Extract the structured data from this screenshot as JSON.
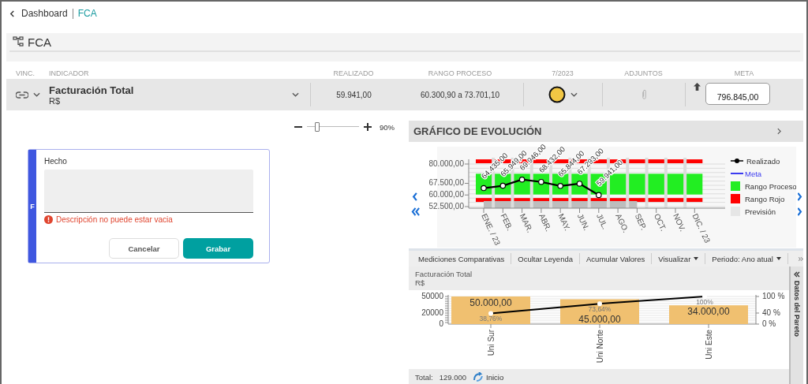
{
  "breadcrumb": [
    {
      "label": "Dashboard",
      "selected": false
    },
    {
      "label": "FCA",
      "selected": true
    }
  ],
  "section": {
    "title": "FCA"
  },
  "table": {
    "columns": [
      "VINC.",
      "INDICADOR",
      "REALIZADO",
      "RANGO PROCESO",
      "7/2023",
      "ADJUNTOS",
      "META"
    ],
    "row": {
      "indicator": "Facturación Total",
      "unit": "R$",
      "realizado": "59.941,00",
      "rango_proceso": "60.300,90 a 73.701,10",
      "status_dot": {
        "color": "#f2c744"
      },
      "trend_up": true,
      "meta": "796.845,00"
    }
  },
  "zoom": {
    "level": 0.18,
    "reading": "90%"
  },
  "form": {
    "side_label": "F",
    "field_label": "Hecho",
    "error": "Descripción no puede estar vacia",
    "buttons": [
      {
        "label": "Cancelar",
        "kind": "secondary"
      },
      {
        "label": "Grabar",
        "kind": "primary"
      }
    ]
  },
  "evolution": {
    "title": "GRÁFICO DE EVOLUCIÓN",
    "chart_data": {
      "type": "line",
      "categories": [
        "ENE. / 23",
        "FEB.",
        "MAR.",
        "ABR.",
        "MAY.",
        "JUN.",
        "JUL.",
        "AGO.",
        "SEP.",
        "OCT.",
        "NOV.",
        "DIC. / 23"
      ],
      "series": [
        {
          "name": "Realizado",
          "color": "#000000",
          "marker": "circle",
          "values": [
            64435,
            65949,
            69946,
            68432,
            65844,
            67293,
            59941,
            null,
            null,
            null,
            null,
            null
          ]
        }
      ],
      "bands": [
        {
          "axis": "y",
          "from": 60300.9,
          "to": 73701.1,
          "color": "#22ee22"
        },
        {
          "axis": "y",
          "from": 80500,
          "to": 83000,
          "color": "#ff0000"
        },
        {
          "axis": "y",
          "from": 55500,
          "to": 58000,
          "color": "#ff0000"
        },
        {
          "axis": "x",
          "from": "ENE. / 23",
          "to": "SEP.",
          "color": "#bdbdbd"
        }
      ],
      "value_labels": [
        "64.435,00",
        "65.949,00",
        "69.946,00",
        "68.432,00",
        "65.844,00",
        "67.293,00",
        "59.941,00",
        null,
        null,
        null,
        null,
        null
      ],
      "ylim": [
        52500,
        80000
      ],
      "yticks": [
        {
          "value": 80000,
          "label": "80.000,00"
        },
        {
          "value": 67500,
          "label": "67.500,00"
        },
        {
          "value": 60000,
          "label": "60.000,00"
        },
        {
          "value": 52500,
          "label": "52.500,00"
        }
      ]
    },
    "legend": [
      {
        "label": "Meta",
        "kind": "line",
        "color": "#3b3bf0"
      },
      {
        "label": "Rango Proceso",
        "kind": "box",
        "color": "#22ee22"
      },
      {
        "label": "Rango Rojo",
        "kind": "box",
        "color": "#ff0000"
      },
      {
        "label": "Previsión",
        "kind": "box",
        "color": "#e6e6e6"
      }
    ]
  },
  "toolbar": [
    {
      "label": "Mediciones Comparativas",
      "dropdown": false
    },
    {
      "label": "Ocultar Leyenda",
      "dropdown": false
    },
    {
      "label": "Acumular Valores",
      "dropdown": false
    },
    {
      "label": "Visualizar",
      "dropdown": true
    },
    {
      "label": "Periodo: Ano atual",
      "dropdown": true
    }
  ],
  "pareto": {
    "title": "Facturación Total",
    "unit": "R$",
    "chart_data": {
      "type": "bar",
      "categories": [
        "Uni Sur",
        "Uni Norte",
        "Uni Este"
      ],
      "series": [
        {
          "color": "#f0c070",
          "values": [
            50000,
            45000,
            34000
          ],
          "value_labels": [
            "50.000,00",
            "45.000,00",
            "34.000,00"
          ]
        },
        {
          "color": "#000000",
          "values": [
            38.76,
            73.64,
            100
          ],
          "value_labels": [
            "38,76%",
            "73,64%",
            "100%"
          ]
        }
      ],
      "ylim": [
        0,
        50000
      ],
      "yticks": [
        0,
        20000,
        50000
      ],
      "y2lim": [
        0,
        100
      ],
      "y2ticks": [
        {
          "value": 100,
          "label": "100 %"
        },
        {
          "value": 40,
          "label": "40 %"
        },
        {
          "value": 0,
          "label": "0 %"
        }
      ]
    },
    "side_tab": "Datos del Pareto",
    "total_label": "Total:",
    "total": "129.000",
    "home": "Inicio"
  }
}
